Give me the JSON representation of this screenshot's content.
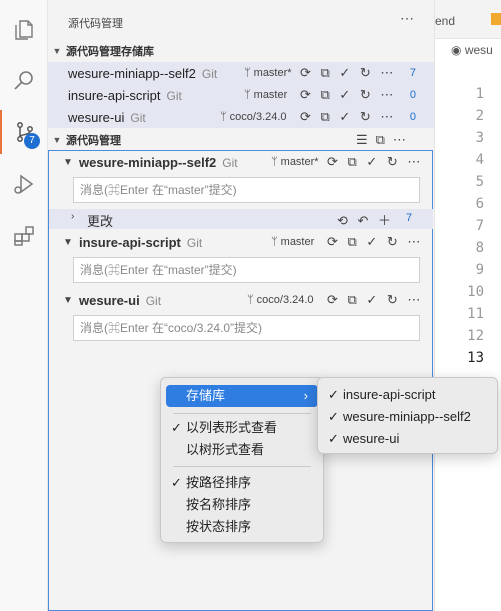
{
  "activity_bar": {
    "scm_badge": "7"
  },
  "sidebar": {
    "title": "源代码管理",
    "repos_section_title": "源代码管理存储库",
    "repos": [
      {
        "name": "wesure-miniapp--self2",
        "git": "Git",
        "branch": "master*",
        "count": "7"
      },
      {
        "name": "insure-api-script",
        "git": "Git",
        "branch": "master",
        "count": "0"
      },
      {
        "name": "wesure-ui",
        "git": "Git",
        "branch": "coco/3.24.0",
        "count": "0"
      }
    ],
    "scm_section_title": "源代码管理",
    "groups": [
      {
        "name": "wesure-miniapp--self2",
        "git": "Git",
        "branch": "master*",
        "placeholder": "消息(⌘Enter 在“master”提交)"
      },
      {
        "name": "insure-api-script",
        "git": "Git",
        "branch": "master",
        "placeholder": "消息(⌘Enter 在“master”提交)"
      },
      {
        "name": "wesure-ui",
        "git": "Git",
        "branch": "coco/3.24.0",
        "placeholder": "消息(⌘Enter 在“coco/3.24.0”提交)"
      }
    ],
    "changes": {
      "label": "更改",
      "count": "7"
    }
  },
  "editor": {
    "tab_partial": "end",
    "breadcrumb": "wesu",
    "line_numbers": [
      "1",
      "2",
      "3",
      "4",
      "5",
      "6",
      "7",
      "8",
      "9",
      "10",
      "11",
      "12",
      "13"
    ],
    "current_line": "13"
  },
  "context_menu": {
    "repositories": "存储库",
    "list_view": "以列表形式查看",
    "tree_view": "以树形式查看",
    "sort_by_path": "按路径排序",
    "sort_by_name": "按名称排序",
    "sort_by_status": "按状态排序"
  },
  "submenu": {
    "items": [
      "insure-api-script",
      "wesure-miniapp--self2",
      "wesure-ui"
    ]
  },
  "colors": {
    "accent": "#2f7de1",
    "badge": "#1f6fd0",
    "active_indicator": "#e8743b",
    "focus_border": "#4a8bdc"
  }
}
